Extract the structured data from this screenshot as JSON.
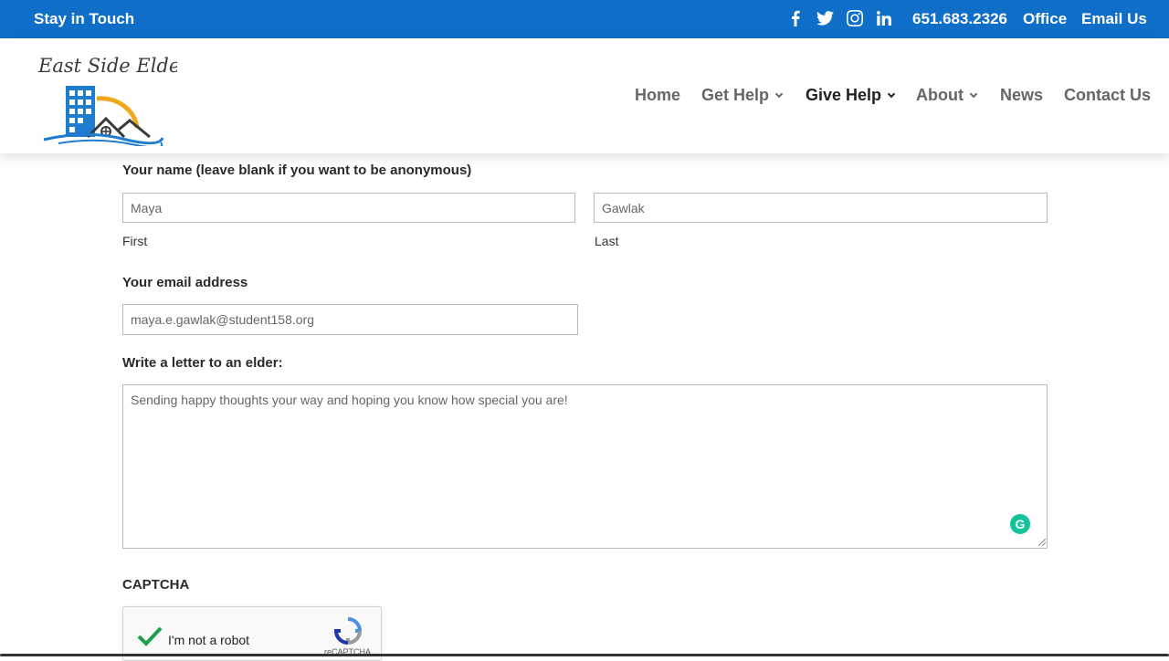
{
  "topbar": {
    "left_text": "Stay in Touch",
    "social_icons": [
      "facebook-icon",
      "twitter-icon",
      "instagram-icon",
      "linkedin-icon"
    ],
    "phone": "651.683.2326",
    "office": "Office",
    "email": "Email Us",
    "bg_color": "#0f6ec7"
  },
  "header": {
    "logo_text": "East Side Elders",
    "nav": [
      {
        "label": "Home",
        "has_dropdown": false
      },
      {
        "label": "Get Help",
        "has_dropdown": true
      },
      {
        "label": "Give Help",
        "has_dropdown": true,
        "active": true
      },
      {
        "label": "About",
        "has_dropdown": true
      },
      {
        "label": "News",
        "has_dropdown": false
      },
      {
        "label": "Contact Us",
        "has_dropdown": false
      }
    ]
  },
  "form": {
    "name_label": "Your name (leave blank if you want to be anonymous)",
    "first_value": "Maya",
    "first_sub": "First",
    "last_value": "Gawlak",
    "last_sub": "Last",
    "email_label": "Your email address",
    "email_value": "maya.e.gawlak@student158.org",
    "letter_label": "Write a letter to an elder:",
    "letter_value": "Sending happy thoughts your way and hoping you know how special you are!",
    "captcha_label": "CAPTCHA",
    "captcha_text": "I'm not a robot",
    "captcha_brand": "reCAPTCHA"
  }
}
